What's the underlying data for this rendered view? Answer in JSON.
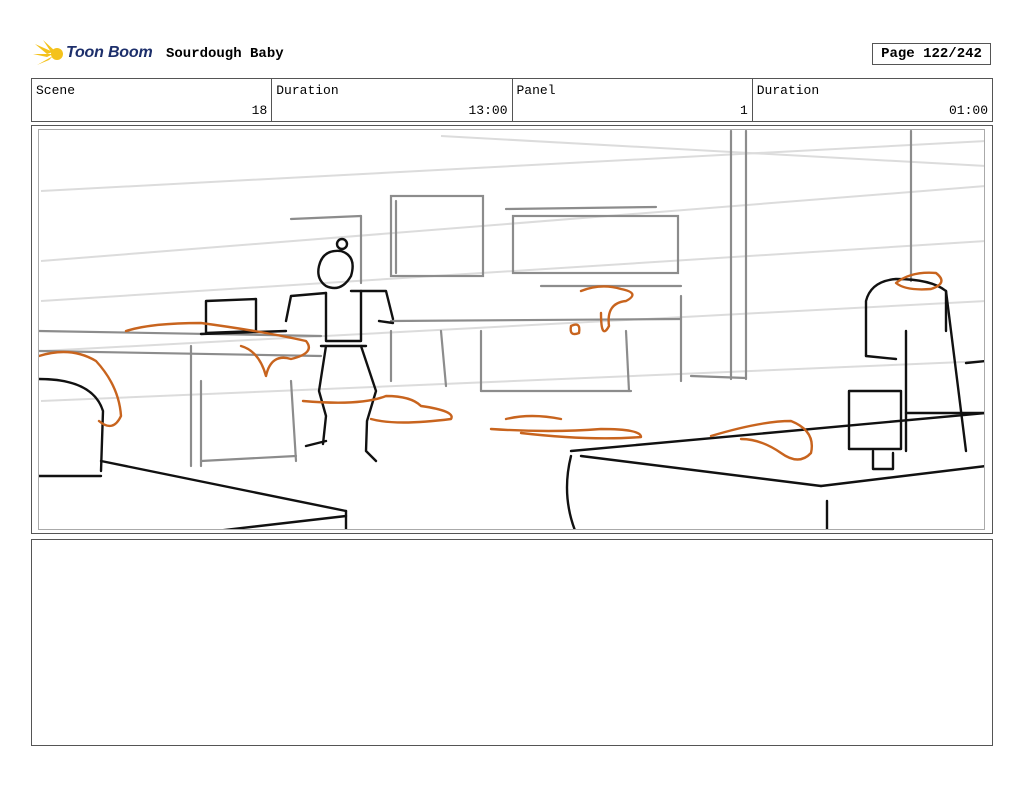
{
  "header": {
    "logo_text": "Toon Boom",
    "project_title": "Sourdough Baby",
    "page_label": "Page 122/242"
  },
  "info": {
    "scene_label": "Scene",
    "scene_value": "18",
    "scene_duration_label": "Duration",
    "scene_duration_value": "13:00",
    "panel_label": "Panel",
    "panel_value": "1",
    "panel_duration_label": "Duration",
    "panel_duration_value": "01:00"
  },
  "colors": {
    "sketch_black": "#111111",
    "sketch_grey": "#8c8c8c",
    "sketch_orange": "#c8641e",
    "logo_yellow": "#f4c21c",
    "logo_blue": "#1d2f6b"
  },
  "panel": {
    "content": "sketch-drawing"
  },
  "notes": {
    "text": ""
  }
}
